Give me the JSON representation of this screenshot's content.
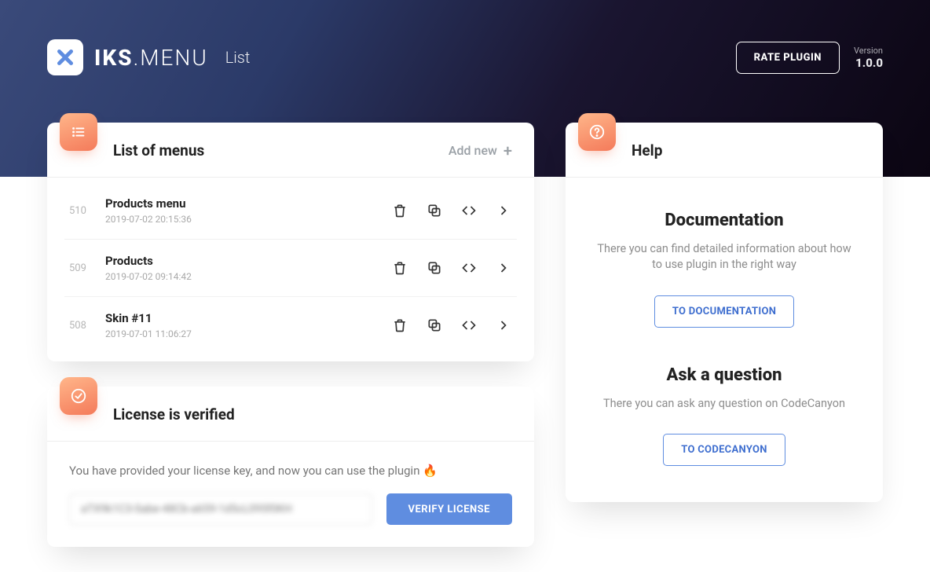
{
  "header": {
    "brand_bold": "IKS",
    "brand_thin": "MENU",
    "page_name": "List",
    "rate_label": "RATE PLUGIN",
    "version_label": "Version",
    "version_number": "1.0.0"
  },
  "menus_card": {
    "title": "List of menus",
    "add_new_label": "Add new",
    "items": [
      {
        "id": "510",
        "title": "Products menu",
        "timestamp": "2019-07-02 20:15:36"
      },
      {
        "id": "509",
        "title": "Products",
        "timestamp": "2019-07-02 09:14:42"
      },
      {
        "id": "508",
        "title": "Skin #11",
        "timestamp": "2019-07-01 11:06:27"
      }
    ]
  },
  "license_card": {
    "title": "License is verified",
    "message": "You have provided your license key, and now you can use the plugin 🔥",
    "input_value": "aTX9k1C3-Sabe-48Cb-a659-1d5cL095f0KH",
    "verify_label": "VERIFY LICENSE"
  },
  "help_card": {
    "title": "Help",
    "documentation": {
      "heading": "Documentation",
      "desc": "There you can find detailed information about how to use plugin in the right way",
      "button": "TO DOCUMENTATION"
    },
    "question": {
      "heading": "Ask a question",
      "desc": "There you can ask any question on CodeCanyon",
      "button": "TO CODECANYON"
    }
  }
}
